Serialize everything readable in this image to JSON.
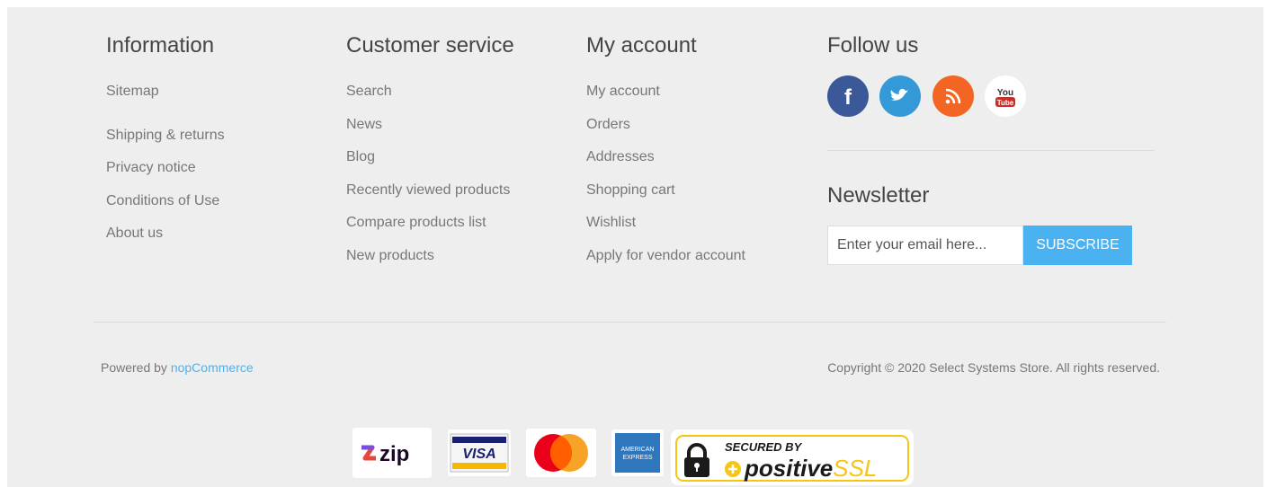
{
  "information": {
    "title": "Information",
    "links": [
      "Sitemap",
      "Shipping & returns",
      "Privacy notice",
      "Conditions of Use",
      "About us"
    ]
  },
  "customer_service": {
    "title": "Customer service",
    "links": [
      "Search",
      "News",
      "Blog",
      "Recently viewed products",
      "Compare products list",
      "New products"
    ]
  },
  "my_account": {
    "title": "My account",
    "links": [
      "My account",
      "Orders",
      "Addresses",
      "Shopping cart",
      "Wishlist",
      "Apply for vendor account"
    ]
  },
  "follow_us": {
    "title": "Follow us",
    "icons": [
      "facebook-icon",
      "twitter-icon",
      "rss-icon",
      "youtube-icon"
    ],
    "colors": {
      "facebook": "#3b5998",
      "twitter": "#3399d7",
      "rss": "#f26522",
      "youtube": "#ffffff"
    },
    "youtube_top": "You",
    "youtube_bottom": "Tube"
  },
  "newsletter": {
    "title": "Newsletter",
    "placeholder": "Enter your email here...",
    "button_label": "SUBSCRIBE",
    "button_color": "#4ab2f1"
  },
  "footer_bottom": {
    "powered_prefix": "Powered by",
    "powered_link": "nopCommerce",
    "copyright": "Copyright © 2020 Select Systems Store. All rights reserved."
  },
  "payments": {
    "zip": "zip",
    "visa": "VISA",
    "amex_top": "AMERICAN",
    "amex_bottom": "EXPRESS",
    "ssl_top": "SECURED BY",
    "ssl_main": "positive",
    "ssl_suffix": "SSL"
  }
}
